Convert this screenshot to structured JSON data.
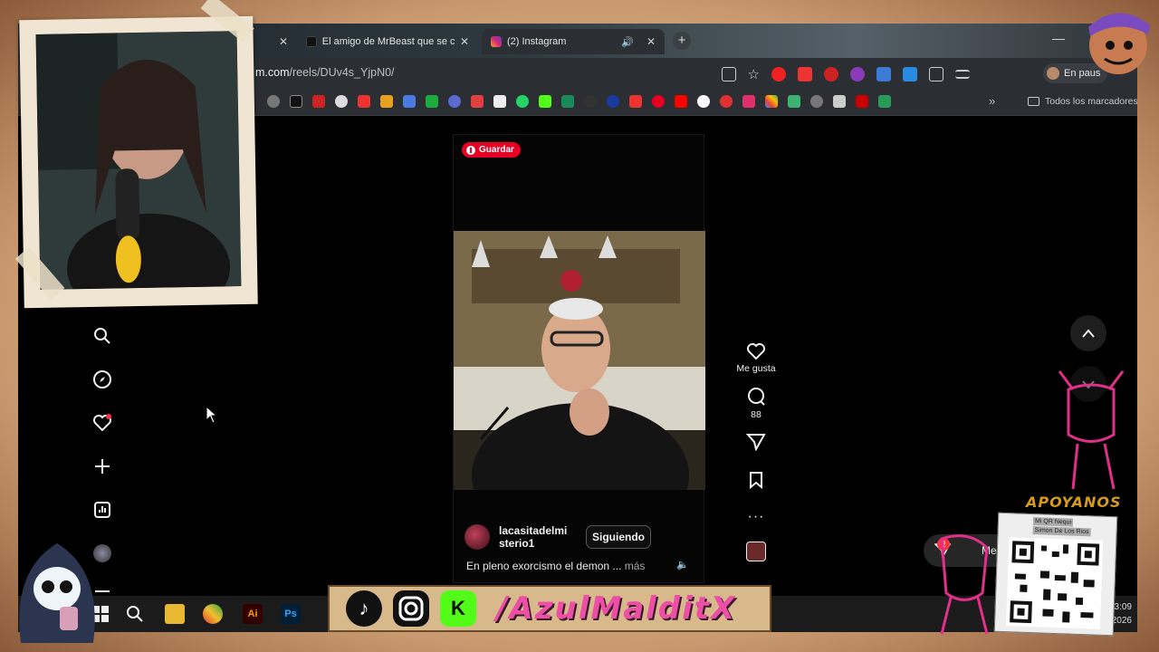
{
  "browser": {
    "tabs": [
      {
        "title": "El amigo de MrBeast que se co",
        "close": "✕"
      },
      {
        "title": "(2) Instagram",
        "close": "✕"
      }
    ],
    "first_tab_close": "✕",
    "new_tab": "+",
    "address": {
      "prefix": "m.com",
      "path": "/reels/DUv4s_YjpN0/"
    },
    "profile_label": "En paus",
    "bookmarks_all": "Todos los marcadores",
    "bookmarks_more": "»"
  },
  "reel": {
    "save_label": "Guardar",
    "username": "lacasitadelmi sterio1",
    "follow_label": "Siguiendo",
    "caption": "En pleno exorcismo el demon ...",
    "caption_more": "más"
  },
  "actions": {
    "like_label": "Me gusta",
    "comments_count": "88"
  },
  "messages": {
    "label": "Mens",
    "badge": "2"
  },
  "taskbar": {
    "time": "23:09",
    "date": "02/2026"
  },
  "overlay": {
    "handle": "/AzulMalditX",
    "support_title": "APOYANOS",
    "qr_label_1": "Mi QR Nequi",
    "qr_label_2": "Simon De Los Rios"
  },
  "colors": {
    "accent_pink": "#ec4fa5",
    "instagram_red": "#ff3040",
    "pinterest_red": "#e60023",
    "frame": "#c99a70"
  }
}
